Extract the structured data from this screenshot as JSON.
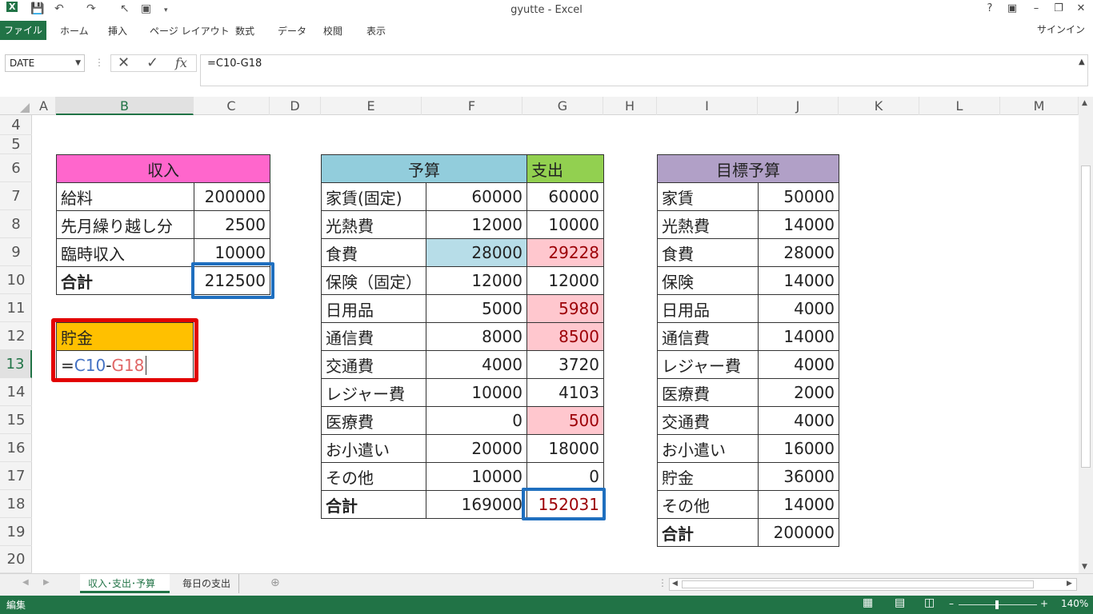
{
  "window": {
    "title": "gyutte - Excel",
    "help": "?",
    "signin": "サインイン"
  },
  "ribbon": {
    "file": "ファイル",
    "tabs": [
      "ホーム",
      "挿入",
      "ページ レイアウト",
      "数式",
      "データ",
      "校閲",
      "表示"
    ]
  },
  "formula_bar": {
    "name_box": "DATE",
    "formula": "=C10-G18"
  },
  "grid": {
    "columns": [
      "A",
      "B",
      "C",
      "D",
      "E",
      "F",
      "G",
      "H",
      "I",
      "J",
      "K",
      "L",
      "M"
    ],
    "rows": [
      "4",
      "5",
      "6",
      "7",
      "8",
      "9",
      "10",
      "11",
      "12",
      "13",
      "14",
      "15",
      "16",
      "17",
      "18",
      "19",
      "20"
    ],
    "active_column": "B",
    "active_row": "13"
  },
  "income": {
    "header": "収入",
    "rows": [
      {
        "label": "給料",
        "value": "200000"
      },
      {
        "label": "先月繰り越し分",
        "value": "2500"
      },
      {
        "label": "臨時収入",
        "value": "10000"
      }
    ],
    "total_label": "合計",
    "total_value": "212500"
  },
  "savings": {
    "header": "貯金",
    "formula_eq": "=",
    "formula_ref1": "C10",
    "formula_minus": "-",
    "formula_ref2": "G18"
  },
  "budget": {
    "header_budget": "予算",
    "header_spent": "支出",
    "rows": [
      {
        "label": "家賃(固定)",
        "budget": "60000",
        "spent": "60000"
      },
      {
        "label": "光熱費",
        "budget": "12000",
        "spent": "10000"
      },
      {
        "label": "食費",
        "budget": "28000",
        "spent": "29228"
      },
      {
        "label": "保険（固定）",
        "budget": "12000",
        "spent": "12000"
      },
      {
        "label": "日用品",
        "budget": "5000",
        "spent": "5980"
      },
      {
        "label": "通信費",
        "budget": "8000",
        "spent": "8500"
      },
      {
        "label": "交通費",
        "budget": "4000",
        "spent": "3720"
      },
      {
        "label": "レジャー費",
        "budget": "10000",
        "spent": "4103"
      },
      {
        "label": "医療費",
        "budget": "0",
        "spent": "500"
      },
      {
        "label": "お小遣い",
        "budget": "20000",
        "spent": "18000"
      },
      {
        "label": "その他",
        "budget": "10000",
        "spent": "0"
      }
    ],
    "total_label": "合計",
    "total_budget": "169000",
    "total_spent": "152031",
    "over_budget_color": "#ffc7ce"
  },
  "target": {
    "header": "目標予算",
    "rows": [
      {
        "label": "家賃",
        "value": "50000"
      },
      {
        "label": "光熱費",
        "value": "14000"
      },
      {
        "label": "食費",
        "value": "28000"
      },
      {
        "label": "保険",
        "value": "14000"
      },
      {
        "label": "日用品",
        "value": "4000"
      },
      {
        "label": "通信費",
        "value": "14000"
      },
      {
        "label": "レジャー費",
        "value": "4000"
      },
      {
        "label": "医療費",
        "value": "2000"
      },
      {
        "label": "交通費",
        "value": "4000"
      },
      {
        "label": "お小遣い",
        "value": "16000"
      },
      {
        "label": "貯金",
        "value": "36000"
      },
      {
        "label": "その他",
        "value": "14000"
      }
    ],
    "total_label": "合計",
    "total_value": "200000"
  },
  "sheets": {
    "tabs": [
      "収入･支出･予算",
      "毎日の支出"
    ],
    "active": "収入･支出･予算"
  },
  "status": {
    "mode": "編集",
    "zoom": "140%"
  },
  "colors": {
    "excel_green": "#217346",
    "income_header": "#ff66cc",
    "budget_header": "#92cddc",
    "spent_header": "#92d050",
    "savings_header": "#ffc000",
    "target_header": "#b1a0c7",
    "highlight_blue": "#1f6fbf",
    "highlight_red": "#e20000"
  }
}
